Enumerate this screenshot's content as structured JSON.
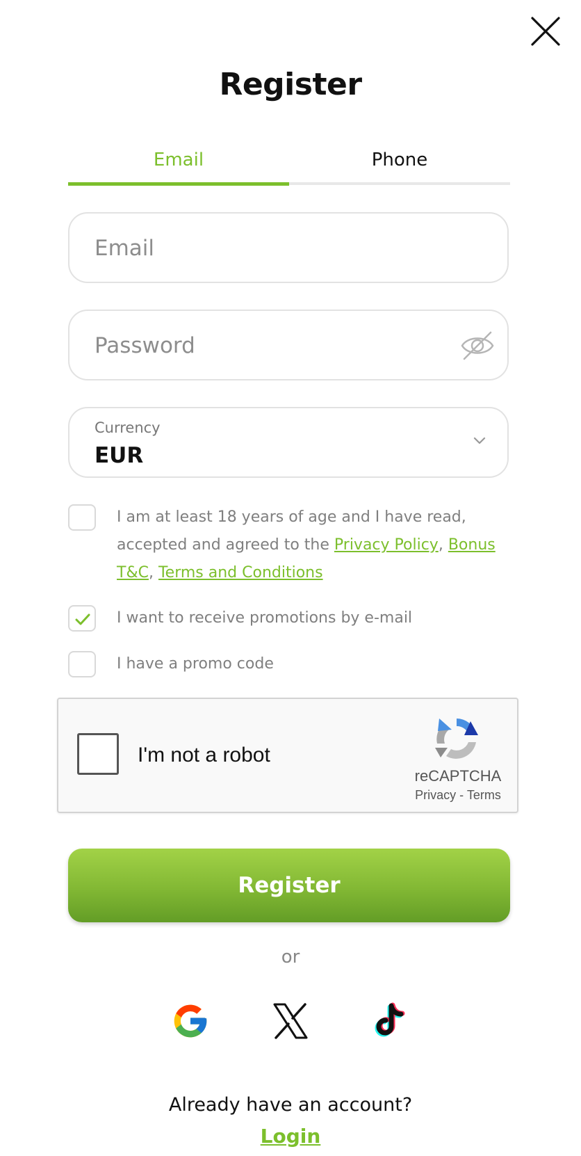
{
  "modal": {
    "title": "Register",
    "close_icon": "close-icon"
  },
  "tabs": [
    {
      "label": "Email",
      "active": true
    },
    {
      "label": "Phone",
      "active": false
    }
  ],
  "accent_color": "#7cbf2c",
  "form": {
    "email_placeholder": "Email",
    "email_value": "",
    "password_placeholder": "Password",
    "password_value": "",
    "password_toggle_icon": "eye-off-icon",
    "currency_label": "Currency",
    "currency_value": "EUR"
  },
  "consents": {
    "age": {
      "checked": false,
      "text_before": "I am at least 18 years of age and I have read, accepted and agreed to the ",
      "link_privacy": "Privacy Policy",
      "sep1": ", ",
      "link_bonus": "Bonus T&C",
      "sep2": ", ",
      "link_terms": "Terms and Conditions"
    },
    "promotions": {
      "checked": true,
      "label": "I want to receive promotions by e-mail"
    },
    "promo_code": {
      "checked": false,
      "label": "I have a promo code"
    }
  },
  "recaptcha": {
    "label": "I'm not a robot",
    "brand": "reCAPTCHA",
    "privacy": "Privacy",
    "separator": "-",
    "terms": "Terms"
  },
  "register_button": "Register",
  "or_label": "or",
  "social": [
    "google-icon",
    "x-icon",
    "tiktok-icon"
  ],
  "footer": {
    "question": "Already have an account?",
    "login_link": "Login"
  }
}
